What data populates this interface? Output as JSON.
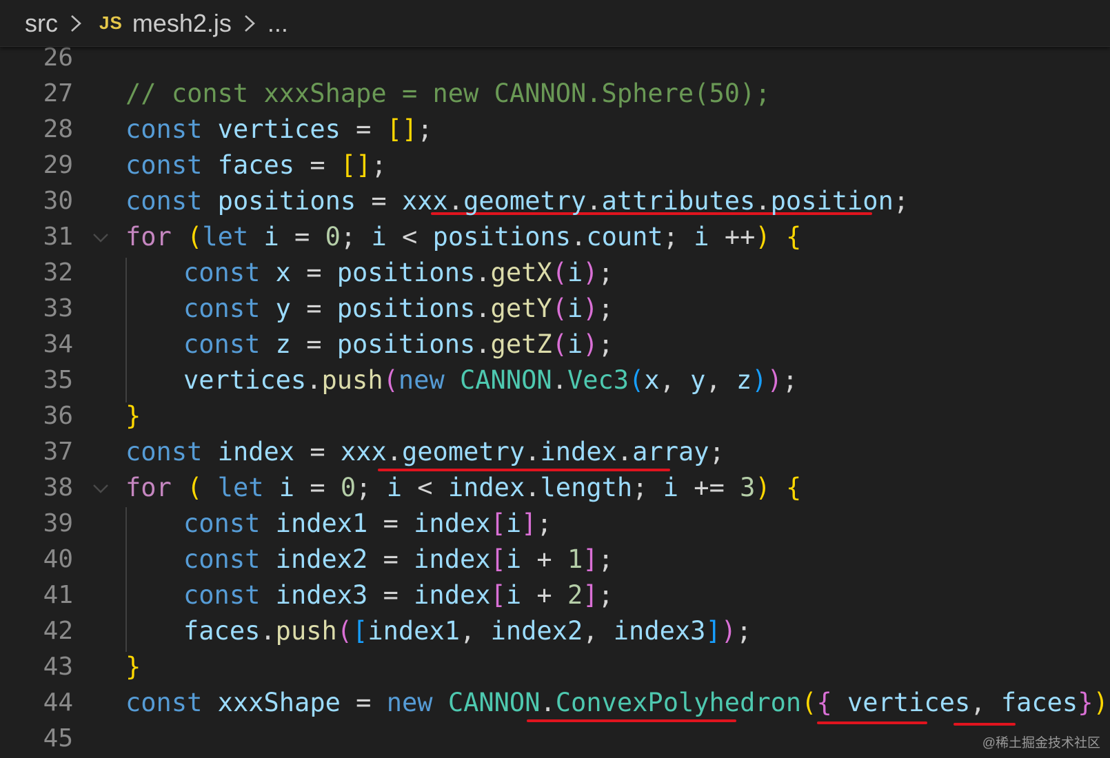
{
  "breadcrumb": {
    "folder": "src",
    "file_icon": "JS",
    "file": "mesh2.js",
    "more": "..."
  },
  "colors": {
    "background": "#1f1f1f",
    "keyword": "#569cd6",
    "control": "#c586c0",
    "variable": "#9cdcfe",
    "function": "#dcdcaa",
    "class": "#4ec9b0",
    "number": "#b5cea8",
    "comment": "#6a9955",
    "bracket1": "#ffd700",
    "bracket2": "#da70d6",
    "bracket3": "#179fff",
    "punct": "#d4d4d4",
    "underline": "#e0141e"
  },
  "code_lines": [
    {
      "n": "26",
      "indent": 0,
      "tokens": []
    },
    {
      "n": "27",
      "indent": 0,
      "tokens": [
        [
          "// const xxxShape = new CANNON.Sphere(50);",
          "comment"
        ]
      ]
    },
    {
      "n": "28",
      "indent": 0,
      "tokens": [
        [
          "const",
          "keyword"
        ],
        [
          " ",
          "punct"
        ],
        [
          "vertices",
          "variable"
        ],
        [
          " = ",
          "punct"
        ],
        [
          "[]",
          "bracket1"
        ],
        [
          ";",
          "punct"
        ]
      ]
    },
    {
      "n": "29",
      "indent": 0,
      "tokens": [
        [
          "const",
          "keyword"
        ],
        [
          " ",
          "punct"
        ],
        [
          "faces",
          "variable"
        ],
        [
          " = ",
          "punct"
        ],
        [
          "[]",
          "bracket1"
        ],
        [
          ";",
          "punct"
        ]
      ]
    },
    {
      "n": "30",
      "indent": 0,
      "tokens": [
        [
          "const",
          "keyword"
        ],
        [
          " ",
          "punct"
        ],
        [
          "positions",
          "variable"
        ],
        [
          " = ",
          "punct"
        ],
        [
          "xxx",
          "variable"
        ],
        [
          ".",
          "punct"
        ],
        [
          "geometry",
          "variable"
        ],
        [
          ".",
          "punct"
        ],
        [
          "attributes",
          "variable"
        ],
        [
          ".",
          "punct"
        ],
        [
          "position",
          "variable"
        ],
        [
          ";",
          "punct"
        ]
      ]
    },
    {
      "n": "31",
      "indent": 0,
      "fold": true,
      "tokens": [
        [
          "for",
          "control"
        ],
        [
          " ",
          "punct"
        ],
        [
          "(",
          "bracket1"
        ],
        [
          "let",
          "keyword"
        ],
        [
          " ",
          "punct"
        ],
        [
          "i",
          "variable"
        ],
        [
          " = ",
          "punct"
        ],
        [
          "0",
          "number"
        ],
        [
          "; ",
          "punct"
        ],
        [
          "i",
          "variable"
        ],
        [
          " < ",
          "punct"
        ],
        [
          "positions",
          "variable"
        ],
        [
          ".",
          "punct"
        ],
        [
          "count",
          "variable"
        ],
        [
          "; ",
          "punct"
        ],
        [
          "i",
          "variable"
        ],
        [
          " ++",
          "punct"
        ],
        [
          ")",
          "bracket1"
        ],
        [
          " ",
          "punct"
        ],
        [
          "{",
          "bracket1"
        ]
      ]
    },
    {
      "n": "32",
      "indent": 1,
      "tokens": [
        [
          "const",
          "keyword"
        ],
        [
          " ",
          "punct"
        ],
        [
          "x",
          "variable"
        ],
        [
          " = ",
          "punct"
        ],
        [
          "positions",
          "variable"
        ],
        [
          ".",
          "punct"
        ],
        [
          "getX",
          "function"
        ],
        [
          "(",
          "bracket2"
        ],
        [
          "i",
          "variable"
        ],
        [
          ")",
          "bracket2"
        ],
        [
          ";",
          "punct"
        ]
      ]
    },
    {
      "n": "33",
      "indent": 1,
      "tokens": [
        [
          "const",
          "keyword"
        ],
        [
          " ",
          "punct"
        ],
        [
          "y",
          "variable"
        ],
        [
          " = ",
          "punct"
        ],
        [
          "positions",
          "variable"
        ],
        [
          ".",
          "punct"
        ],
        [
          "getY",
          "function"
        ],
        [
          "(",
          "bracket2"
        ],
        [
          "i",
          "variable"
        ],
        [
          ")",
          "bracket2"
        ],
        [
          ";",
          "punct"
        ]
      ]
    },
    {
      "n": "34",
      "indent": 1,
      "tokens": [
        [
          "const",
          "keyword"
        ],
        [
          " ",
          "punct"
        ],
        [
          "z",
          "variable"
        ],
        [
          " = ",
          "punct"
        ],
        [
          "positions",
          "variable"
        ],
        [
          ".",
          "punct"
        ],
        [
          "getZ",
          "function"
        ],
        [
          "(",
          "bracket2"
        ],
        [
          "i",
          "variable"
        ],
        [
          ")",
          "bracket2"
        ],
        [
          ";",
          "punct"
        ]
      ]
    },
    {
      "n": "35",
      "indent": 1,
      "tokens": [
        [
          "vertices",
          "variable"
        ],
        [
          ".",
          "punct"
        ],
        [
          "push",
          "function"
        ],
        [
          "(",
          "bracket2"
        ],
        [
          "new",
          "keyword"
        ],
        [
          " ",
          "punct"
        ],
        [
          "CANNON",
          "class"
        ],
        [
          ".",
          "punct"
        ],
        [
          "Vec3",
          "class"
        ],
        [
          "(",
          "bracket3"
        ],
        [
          "x",
          "variable"
        ],
        [
          ", ",
          "punct"
        ],
        [
          "y",
          "variable"
        ],
        [
          ", ",
          "punct"
        ],
        [
          "z",
          "variable"
        ],
        [
          ")",
          "bracket3"
        ],
        [
          ")",
          "bracket2"
        ],
        [
          ";",
          "punct"
        ]
      ]
    },
    {
      "n": "36",
      "indent": 0,
      "tokens": [
        [
          "}",
          "bracket1"
        ]
      ]
    },
    {
      "n": "37",
      "indent": 0,
      "tokens": [
        [
          "const",
          "keyword"
        ],
        [
          " ",
          "punct"
        ],
        [
          "index",
          "variable"
        ],
        [
          " = ",
          "punct"
        ],
        [
          "xxx",
          "variable"
        ],
        [
          ".",
          "punct"
        ],
        [
          "geometry",
          "variable"
        ],
        [
          ".",
          "punct"
        ],
        [
          "index",
          "variable"
        ],
        [
          ".",
          "punct"
        ],
        [
          "array",
          "variable"
        ],
        [
          ";",
          "punct"
        ]
      ]
    },
    {
      "n": "38",
      "indent": 0,
      "fold": true,
      "tokens": [
        [
          "for",
          "control"
        ],
        [
          " ",
          "punct"
        ],
        [
          "(",
          "bracket1"
        ],
        [
          " ",
          "punct"
        ],
        [
          "let",
          "keyword"
        ],
        [
          " ",
          "punct"
        ],
        [
          "i",
          "variable"
        ],
        [
          " = ",
          "punct"
        ],
        [
          "0",
          "number"
        ],
        [
          "; ",
          "punct"
        ],
        [
          "i",
          "variable"
        ],
        [
          " < ",
          "punct"
        ],
        [
          "index",
          "variable"
        ],
        [
          ".",
          "punct"
        ],
        [
          "length",
          "variable"
        ],
        [
          "; ",
          "punct"
        ],
        [
          "i",
          "variable"
        ],
        [
          " += ",
          "punct"
        ],
        [
          "3",
          "number"
        ],
        [
          ")",
          "bracket1"
        ],
        [
          " ",
          "punct"
        ],
        [
          "{",
          "bracket1"
        ]
      ]
    },
    {
      "n": "39",
      "indent": 1,
      "tokens": [
        [
          "const",
          "keyword"
        ],
        [
          " ",
          "punct"
        ],
        [
          "index1",
          "variable"
        ],
        [
          " = ",
          "punct"
        ],
        [
          "index",
          "variable"
        ],
        [
          "[",
          "bracket2"
        ],
        [
          "i",
          "variable"
        ],
        [
          "]",
          "bracket2"
        ],
        [
          ";",
          "punct"
        ]
      ]
    },
    {
      "n": "40",
      "indent": 1,
      "tokens": [
        [
          "const",
          "keyword"
        ],
        [
          " ",
          "punct"
        ],
        [
          "index2",
          "variable"
        ],
        [
          " = ",
          "punct"
        ],
        [
          "index",
          "variable"
        ],
        [
          "[",
          "bracket2"
        ],
        [
          "i",
          "variable"
        ],
        [
          " + ",
          "punct"
        ],
        [
          "1",
          "number"
        ],
        [
          "]",
          "bracket2"
        ],
        [
          ";",
          "punct"
        ]
      ]
    },
    {
      "n": "41",
      "indent": 1,
      "tokens": [
        [
          "const",
          "keyword"
        ],
        [
          " ",
          "punct"
        ],
        [
          "index3",
          "variable"
        ],
        [
          " = ",
          "punct"
        ],
        [
          "index",
          "variable"
        ],
        [
          "[",
          "bracket2"
        ],
        [
          "i",
          "variable"
        ],
        [
          " + ",
          "punct"
        ],
        [
          "2",
          "number"
        ],
        [
          "]",
          "bracket2"
        ],
        [
          ";",
          "punct"
        ]
      ]
    },
    {
      "n": "42",
      "indent": 1,
      "tokens": [
        [
          "faces",
          "variable"
        ],
        [
          ".",
          "punct"
        ],
        [
          "push",
          "function"
        ],
        [
          "(",
          "bracket2"
        ],
        [
          "[",
          "bracket3"
        ],
        [
          "index1",
          "variable"
        ],
        [
          ", ",
          "punct"
        ],
        [
          "index2",
          "variable"
        ],
        [
          ", ",
          "punct"
        ],
        [
          "index3",
          "variable"
        ],
        [
          "]",
          "bracket3"
        ],
        [
          ")",
          "bracket2"
        ],
        [
          ";",
          "punct"
        ]
      ]
    },
    {
      "n": "43",
      "indent": 0,
      "tokens": [
        [
          "}",
          "bracket1"
        ]
      ]
    },
    {
      "n": "44",
      "indent": 0,
      "tokens": [
        [
          "const",
          "keyword"
        ],
        [
          " ",
          "punct"
        ],
        [
          "xxxShape",
          "variable"
        ],
        [
          " = ",
          "punct"
        ],
        [
          "new",
          "keyword"
        ],
        [
          " ",
          "punct"
        ],
        [
          "CANNON",
          "class"
        ],
        [
          ".",
          "punct"
        ],
        [
          "ConvexPolyhedron",
          "class"
        ],
        [
          "(",
          "bracket1"
        ],
        [
          "{",
          "bracket2"
        ],
        [
          " ",
          "punct"
        ],
        [
          "vertices",
          "variable"
        ],
        [
          ", ",
          "punct"
        ],
        [
          "faces",
          "variable"
        ],
        [
          "}",
          "bracket2"
        ],
        [
          ")",
          "bracket1"
        ]
      ]
    },
    {
      "n": "45",
      "indent": 0,
      "tokens": []
    }
  ],
  "watermark": "@稀土掘金技术社区"
}
